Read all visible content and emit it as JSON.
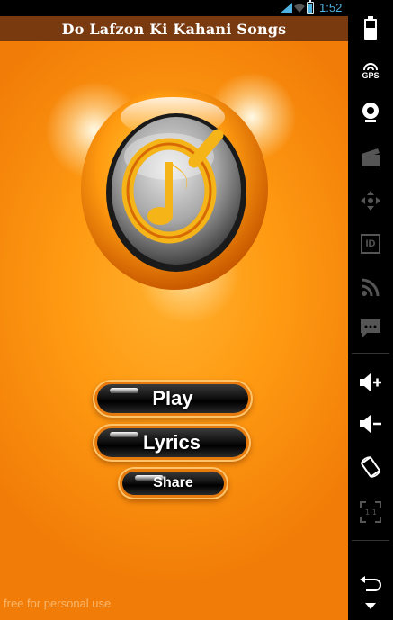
{
  "status_bar": {
    "time": "1:52"
  },
  "app": {
    "title": "Do Lafzon Ki Kahani Songs",
    "buttons": {
      "play": "Play",
      "lyrics": "Lyrics",
      "share": "Share"
    },
    "footer": "free for personal use"
  },
  "sidebar": {
    "gps_label": "GPS",
    "id_label": "ID",
    "icons": [
      "battery-icon",
      "gps-icon",
      "webcam-icon",
      "clapper-icon",
      "dpad-icon",
      "id-icon",
      "rss-icon",
      "sms-icon",
      "volume-up-icon",
      "volume-down-icon",
      "rotate-icon",
      "scale-icon",
      "back-icon",
      "menu-icon"
    ]
  },
  "colors": {
    "orange": "#ff9a12",
    "title_bar": "#7a3a10",
    "time_blue": "#4fb2e0",
    "ring_yellow": "#f5c018"
  }
}
